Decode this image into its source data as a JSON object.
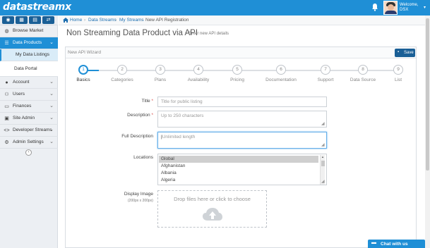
{
  "brand": {
    "logo_text": "datastreamx",
    "accent": "#1f8fd6",
    "dark": "#1a5f96"
  },
  "topbar": {
    "welcome": "Welcome,",
    "user": "DSX",
    "bell_icon": "bell-icon"
  },
  "icon_strip": [
    "dashboard-icon",
    "grid-icon",
    "chart-icon",
    "share-icon"
  ],
  "sidebar": {
    "items": [
      {
        "label": "Browse Market",
        "icon": "globe-icon"
      },
      {
        "label": "Data Products",
        "icon": "list-icon"
      },
      {
        "label": "My Data Listings"
      },
      {
        "label": "Data Portal"
      },
      {
        "label": "Account",
        "icon": "user-icon"
      },
      {
        "label": "Users",
        "icon": "users-icon"
      },
      {
        "label": "Finances",
        "icon": "money-icon"
      },
      {
        "label": "Site Admin",
        "icon": "desktop-icon"
      },
      {
        "label": "Developer Streams",
        "icon": "code-icon"
      },
      {
        "label": "Admin Settings",
        "icon": "gear-icon"
      }
    ]
  },
  "breadcrumb": [
    "Home",
    "Data Streams",
    "My Streams",
    "New API Registration"
  ],
  "page": {
    "title": "Non Streaming Data Product via API",
    "subtitle": "» Enter new API details"
  },
  "wizard": {
    "title": "New API Wizard",
    "save_label": "Save",
    "current_step": 1,
    "steps": [
      {
        "num": "1",
        "label": "Basics"
      },
      {
        "num": "2",
        "label": "Categories"
      },
      {
        "num": "3",
        "label": "Plans"
      },
      {
        "num": "4",
        "label": "Availability"
      },
      {
        "num": "5",
        "label": "Pricing"
      },
      {
        "num": "6",
        "label": "Documentation"
      },
      {
        "num": "7",
        "label": "Support"
      },
      {
        "num": "8",
        "label": "Data Source"
      },
      {
        "num": "9",
        "label": "List"
      }
    ]
  },
  "form": {
    "title_label": "Title",
    "title_placeholder": "Title for public listing",
    "description_label": "Description",
    "description_placeholder": "Up to 250 characters",
    "full_description_label": "Full Description",
    "full_description_placeholder": "Unlimited length",
    "locations_label": "Locations",
    "locations_options": [
      "Global",
      "Afghanistan",
      "Albania",
      "Algeria"
    ],
    "locations_selected": "Global",
    "display_image_label": "Display Image",
    "display_image_hint": "(200px x 200px)",
    "dropzone_text": "Drop files here or click to choose"
  },
  "chat": {
    "label": "Chat with us"
  }
}
